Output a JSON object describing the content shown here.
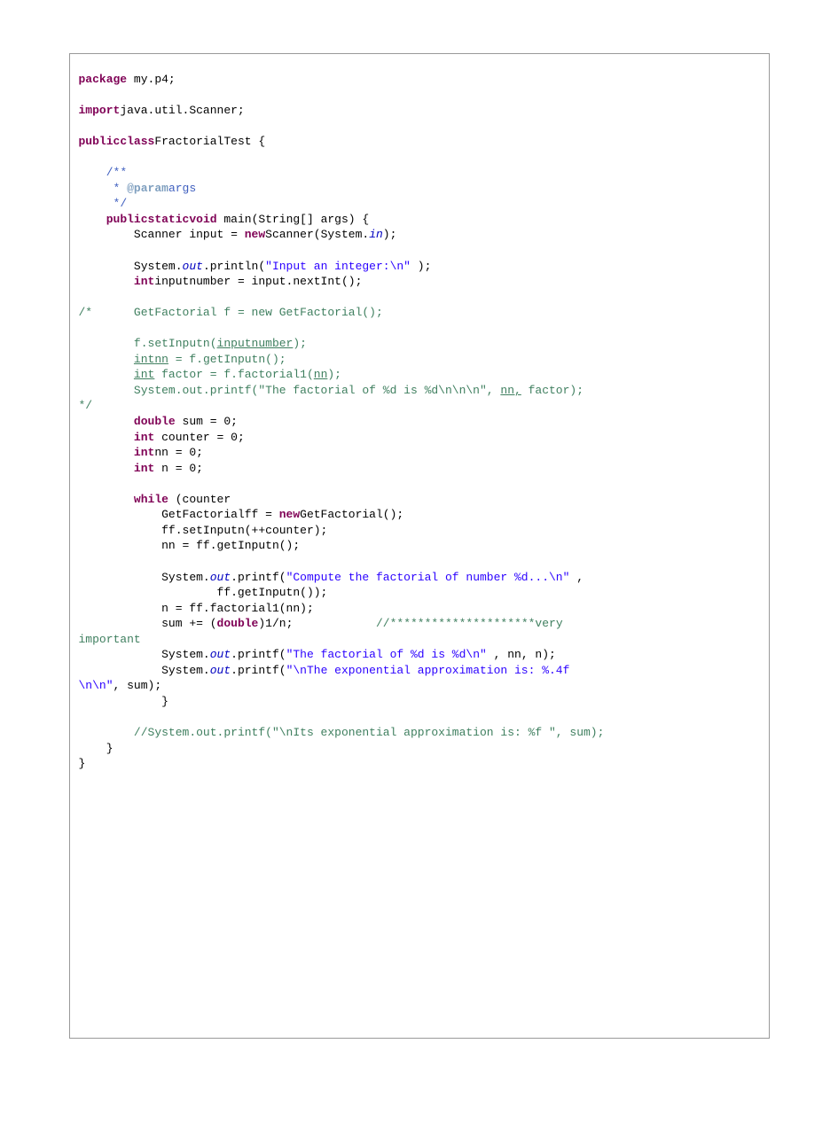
{
  "code": {
    "kw_package": "package",
    "pkg_name": " my.p4;",
    "kw_import": "import",
    "import_name": "java.util.Scanner;",
    "kw_public": "public",
    "kw_class": "class",
    "class_name": "FractorialTest {",
    "jdoc_open": "/**",
    "jdoc_mid_star": " * ",
    "jdoc_param": "@param",
    "jdoc_args": "args",
    "jdoc_close": " */",
    "kw_static": "static",
    "kw_void": "void",
    "main_sig": " main(String[] args) {",
    "scanner_decl_pre": "Scanner input = ",
    "kw_new": "new",
    "scanner_decl_post": "Scanner(System.",
    "sys_in": "in",
    "scanner_decl_end": ");",
    "sys_out_1a": "System.",
    "sf_out": "out",
    "sys_out_1b": ".println(",
    "str_input_int": "\"Input an integer:\\n\"",
    "sys_out_1c": " );",
    "kw_int": "int",
    "inputnum_decl": "inputnumber = input.nextInt();",
    "cmt_block_open": "/*      ",
    "cmt_getfact": "GetFactorial f = new GetFactorial();",
    "cmt_setinputn_a": "f.setInputn(",
    "cmt_setinputn_b": "inputnumber",
    "cmt_setinputn_c": ");",
    "cmt_intnn_a": "int",
    "cmt_intnn_b": "nn",
    "cmt_intnn_c": " = f.getInputn();",
    "cmt_int_a": "int",
    "cmt_int_b": " factor = f.factorial1(",
    "cmt_int_c": "nn",
    "cmt_int_d": ");",
    "cmt_printf_a": "System.out.printf(\"The factorial of %d is %d\\n\\n\\n\", ",
    "cmt_printf_b": "nn,",
    "cmt_printf_c": " factor);",
    "cmt_block_close": "*/",
    "kw_double": "double",
    "decl_sum": " sum = 0;",
    "decl_counter": " counter = 0;",
    "decl_nn": "nn = 0;",
    "decl_n": " n = 0;",
    "kw_while": "while",
    "while_cond": " (counter",
    "gfff_pre": "GetFactorialff = ",
    "gfff_post": "GetFactorial();",
    "ff_set": "ff.setInputn(++counter);",
    "nn_get": "nn = ff.getInputn();",
    "p1_a": "System.",
    "p1_b": ".printf(",
    "p1_str": "\"Compute the factorial of number %d...\\n\"",
    "p1_c": " ,",
    "p1_d": "ff.getInputn());",
    "n_fact": "n = ff.factorial1(nn);",
    "sum_pre": "sum += (",
    "sum_post": ")1/n;",
    "cmt_very": "//*********************very ",
    "cmt_important": "important",
    "p2_a": "System.",
    "p2_b": ".printf(",
    "p2_str": "\"The factorial of %d is %d\\n\"",
    "p2_c": " , nn, n);",
    "p3_a": "System.",
    "p3_b": ".printf(",
    "p3_str_a": "\"\\nThe exponential approximation is: %.4f ",
    "p3_str_b": "\\n\\n\"",
    "p3_c": ", sum);",
    "brace_close": "}",
    "cmt_last": "//System.out.printf(\"\\nIts exponential approximation is: %f \", sum);"
  }
}
